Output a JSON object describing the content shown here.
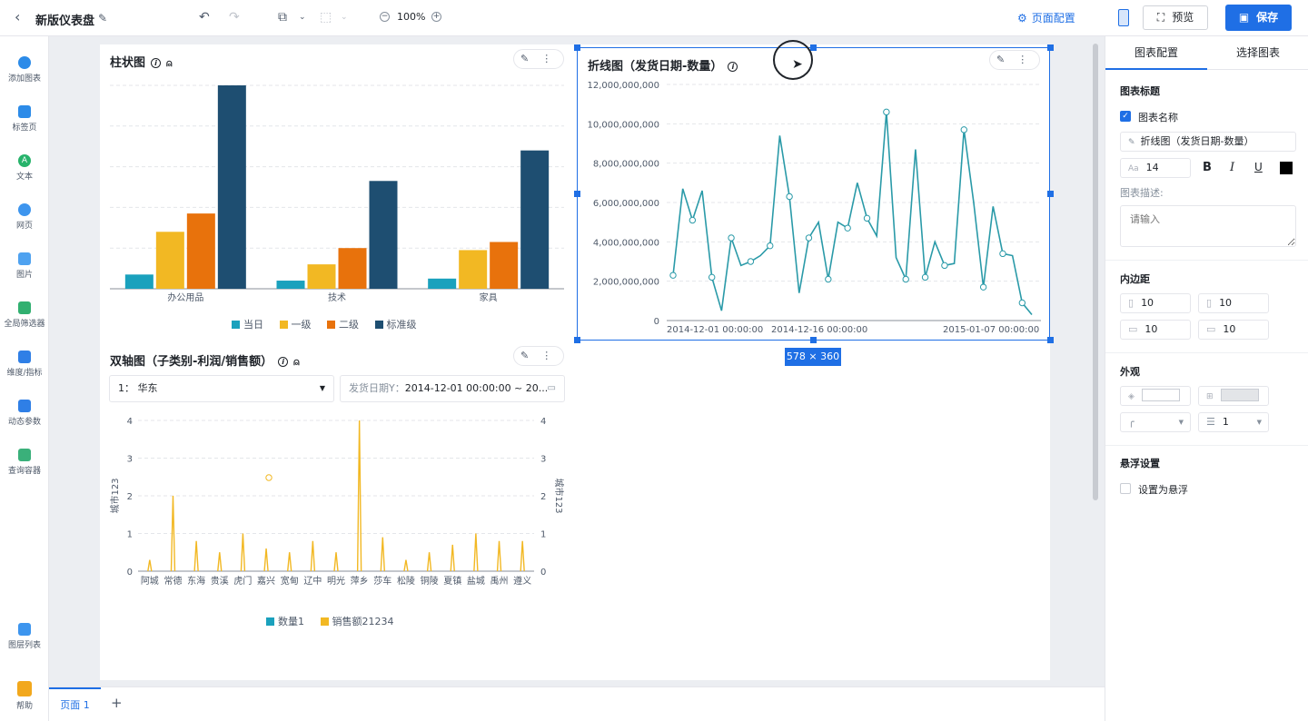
{
  "topbar": {
    "title": "新版仪表盘",
    "zoom": "100%",
    "page_config": "页面配置",
    "preview": "预览",
    "save": "保存"
  },
  "sidebar": {
    "items": [
      {
        "label": "添加图表",
        "icon": "add-chart-icon"
      },
      {
        "label": "标签页",
        "icon": "tab-page-icon"
      },
      {
        "label": "文本",
        "icon": "text-icon"
      },
      {
        "label": "网页",
        "icon": "web-page-icon"
      },
      {
        "label": "图片",
        "icon": "image-icon"
      },
      {
        "label": "全局筛选器",
        "icon": "global-filter-icon"
      },
      {
        "label": "维度/指标",
        "icon": "dimension-metric-icon"
      },
      {
        "label": "动态参数",
        "icon": "dynamic-param-icon"
      },
      {
        "label": "查询容器",
        "icon": "query-container-icon"
      }
    ],
    "layers": "图层列表",
    "help": "帮助"
  },
  "bar_card": {
    "title": "柱状图",
    "legend": [
      "当日",
      "一级",
      "二级",
      "标准级"
    ]
  },
  "line_card": {
    "title": "折线图（发货日期-数量）",
    "size_badge": "578 × 360"
  },
  "dual_card": {
    "title": "双轴图（子类别-利润/销售额）",
    "filter1": "1： 华东",
    "filter2_label": "发货日期Y：",
    "filter2_value": "2014-12-01 00:00:00 ~ 20...",
    "y_left_label": "城市123",
    "y_right_label": "城市123",
    "legend": [
      "数量1",
      "销售额21234"
    ]
  },
  "right_panel": {
    "tabs": [
      "图表配置",
      "选择图表"
    ],
    "title_section": "图表标题",
    "chart_name_label": "图表名称",
    "chart_name_value": "折线图（发货日期-数量）",
    "font_size": "14",
    "desc_label": "图表描述:",
    "desc_placeholder": "请输入",
    "padding_section": "内边距",
    "padding": [
      "10",
      "10",
      "10",
      "10"
    ],
    "appearance_section": "外观",
    "border_width": "1",
    "float_section": "悬浮设置",
    "float_label": "设置为悬浮"
  },
  "bottom": {
    "page_tab": "页面 1",
    "add": "+"
  },
  "colors": {
    "accent": "#1f6fe5",
    "teal": "#1aa1bd",
    "yellow": "#f2b823",
    "orange": "#e8720c",
    "navy": "#1e4e71",
    "line": "#2a9aa8"
  },
  "chart_data": [
    {
      "type": "bar",
      "categories": [
        "办公用品",
        "技术",
        "家具"
      ],
      "series": [
        {
          "name": "当日",
          "values": [
            7,
            4,
            5
          ]
        },
        {
          "name": "一级",
          "values": [
            28,
            12,
            19
          ]
        },
        {
          "name": "二级",
          "values": [
            37,
            20,
            23
          ]
        },
        {
          "name": "标准级",
          "values": [
            100,
            53,
            68
          ]
        }
      ],
      "ylim": [
        0,
        100
      ],
      "grid": true,
      "legend_position": "bottom"
    },
    {
      "type": "line",
      "title": "折线图（发货日期-数量）",
      "x_ticks": [
        "2014-12-01 00:00:00",
        "2014-12-16 00:00:00",
        "2015-01-07 00:00:00"
      ],
      "y_ticks": [
        "0",
        "2,000,000,000",
        "4,000,000,000",
        "6,000,000,000",
        "8,000,000,000",
        "10,000,000,000",
        "12,000,000,000"
      ],
      "ylim": [
        0,
        12000000000
      ],
      "values": [
        2300000000,
        6700000000,
        5100000000,
        6600000000,
        2200000000,
        500000000,
        4200000000,
        2800000000,
        3000000000,
        3300000000,
        3800000000,
        9400000000,
        6300000000,
        1400000000,
        4200000000,
        5000000000,
        2100000000,
        5000000000,
        4700000000,
        7000000000,
        5200000000,
        4300000000,
        10600000000,
        3200000000,
        2100000000,
        8700000000,
        2200000000,
        4000000000,
        2800000000,
        2900000000,
        9700000000,
        6000000000,
        1700000000,
        5800000000,
        3400000000,
        3300000000,
        900000000,
        300000000
      ],
      "grid": true
    },
    {
      "type": "bar",
      "title": "双轴图（子类别-利润/销售额）",
      "categories": [
        "阿城",
        "常德",
        "东海",
        "贵溪",
        "虎门",
        "嘉兴",
        "宽甸",
        "辽中",
        "明光",
        "萍乡",
        "莎车",
        "松陵",
        "铜陵",
        "夏镇",
        "盐城",
        "禹州",
        "遵义"
      ],
      "y_left_ticks": [
        0,
        1,
        2,
        3,
        4
      ],
      "y_right_ticks": [
        0,
        1,
        2,
        3,
        4
      ],
      "ylim": [
        0,
        4
      ],
      "series": [
        {
          "name": "数量1",
          "values": []
        },
        {
          "name": "销售额21234",
          "values": [
            0.3,
            2.0,
            0.8,
            0.5,
            1.0,
            0.6,
            0.5,
            0.8,
            0.5,
            4.0,
            0.9,
            0.3,
            0.5,
            0.7,
            1.0,
            0.8,
            0.8
          ]
        }
      ],
      "grid": true,
      "legend_position": "bottom"
    }
  ]
}
